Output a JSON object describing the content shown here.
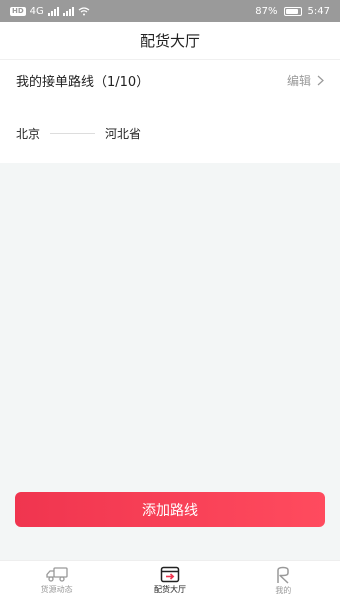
{
  "status_bar": {
    "network_badge": "HD",
    "network_type": "4G",
    "battery_percent": "87%",
    "time": "5:47"
  },
  "header": {
    "title": "配货大厅"
  },
  "route_panel": {
    "title": "我的接单路线（1/10）",
    "edit_label": "编辑",
    "route": {
      "from": "北京",
      "to": "河北省"
    }
  },
  "add_button": {
    "label": "添加路线"
  },
  "tab_bar": {
    "items": [
      {
        "label": "货源动态",
        "icon": "truck-icon",
        "active": false
      },
      {
        "label": "配货大厅",
        "icon": "dispatch-box-icon",
        "active": true
      },
      {
        "label": "我的",
        "icon": "profile-icon",
        "active": false
      }
    ]
  },
  "colors": {
    "accent": "#f0354f",
    "status_bar": "#9a9a9a",
    "background": "#f3f6f6"
  }
}
